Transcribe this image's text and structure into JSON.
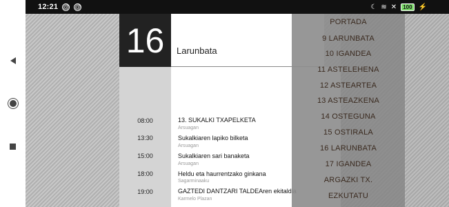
{
  "status_bar": {
    "time": "12:21",
    "battery": "100"
  },
  "schedule": {
    "day_number": "16",
    "day_name": "Larunbata",
    "events": [
      {
        "time": "08:00",
        "title": "13. SUKALKI TXAPELKETA",
        "location": "Arsuagan"
      },
      {
        "time": "13:30",
        "title": "Sukalkiaren lapiko bilketa",
        "location": "Arsuagan"
      },
      {
        "time": "15:00",
        "title": "Sukalkiaren sari banaketa",
        "location": "Arsuagan"
      },
      {
        "time": "18:00",
        "title": "Heldu eta haurrentzako ginkana",
        "location": "Sagarminaaku"
      },
      {
        "time": "19:00",
        "title": "GAZTEDI DANTZARI TALDEAren ekitaldia",
        "location": "Karmelo Plazan"
      }
    ]
  },
  "menu": {
    "items": [
      "PORTADA",
      "9 LARUNBATA",
      "10 IGANDEA",
      "11 ASTELEHENA",
      "12 ASTEARTEA",
      "13 ASTEAZKENA",
      "14 OSTEGUNA",
      "15 OSTIRALA",
      "16 LARUNBATA",
      "17 IGANDEA",
      "ARGAZKI TX.",
      "EZKUTATU"
    ]
  }
}
